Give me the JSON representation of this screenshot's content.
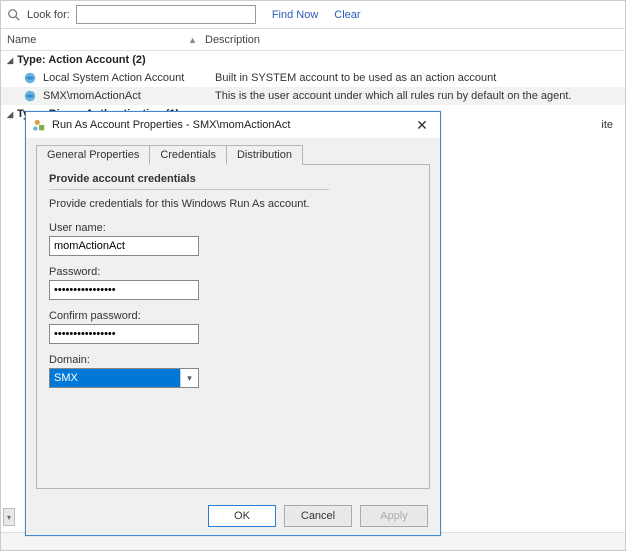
{
  "toolbar": {
    "look_for_label": "Look for:",
    "search_value": "",
    "find_now": "Find Now",
    "clear": "Clear"
  },
  "columns": {
    "name": "Name",
    "description": "Description"
  },
  "groups": [
    {
      "label": "Type: Action Account (2)",
      "rows": [
        {
          "name": "Local System Action Account",
          "description": "Built in SYSTEM account to be used as an action account",
          "selected": false
        },
        {
          "name": "SMX\\momActionAct",
          "description": "This is the user account under which all rules run by default on the agent.",
          "selected": true
        }
      ]
    },
    {
      "label": "Type: Binary Authentication (1)",
      "rows": []
    }
  ],
  "truncated_suffix": "ite",
  "dialog": {
    "title": "Run As Account Properties - SMX\\momActionAct",
    "tabs": {
      "general": "General Properties",
      "credentials": "Credentials",
      "distribution": "Distribution"
    },
    "section_title": "Provide account credentials",
    "helper": "Provide credentials for this Windows Run As account.",
    "labels": {
      "username": "User name:",
      "password": "Password:",
      "confirm": "Confirm password:",
      "domain": "Domain:"
    },
    "values": {
      "username": "momActionAct",
      "password": "••••••••••••••••",
      "confirm": "••••••••••••••••",
      "domain": "SMX"
    },
    "buttons": {
      "ok": "OK",
      "cancel": "Cancel",
      "apply": "Apply"
    }
  }
}
